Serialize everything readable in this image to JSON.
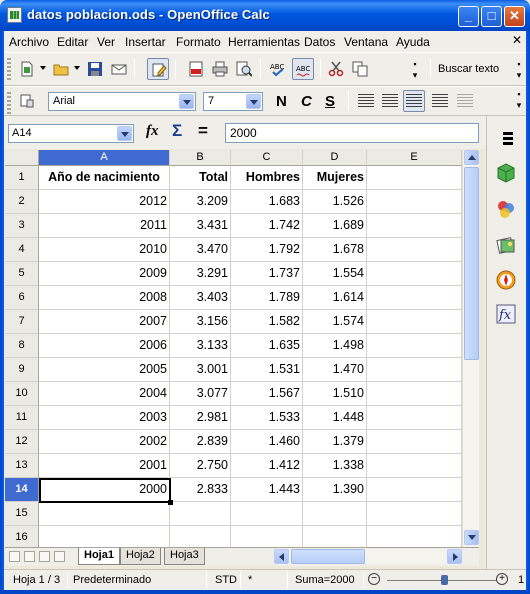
{
  "window": {
    "title": "datos poblacion.ods - OpenOffice Calc",
    "minimize": "_",
    "maximize": "□",
    "close": "✕"
  },
  "menu": [
    "Archivo",
    "Editar",
    "Ver",
    "Insertar",
    "Formato",
    "Herramientas",
    "Datos",
    "Ventana",
    "Ayuda"
  ],
  "menu_close": "✕",
  "toolbar": {
    "find_label": "Buscar texto",
    "font_name": "Arial",
    "font_size": "7",
    "bold": "N",
    "italic": "C",
    "underline": "S"
  },
  "formula_bar": {
    "cell_ref": "A14",
    "fx": "fx",
    "sigma": "Σ",
    "equals": "=",
    "value": "2000"
  },
  "columns": [
    "A",
    "B",
    "C",
    "D",
    "E"
  ],
  "rows": [
    {
      "n": "1",
      "a": "Año de nacimiento",
      "b": "Total",
      "c": "Hombres",
      "d": "Mujeres"
    },
    {
      "n": "2",
      "a": "2012",
      "b": "3.209",
      "c": "1.683",
      "d": "1.526"
    },
    {
      "n": "3",
      "a": "2011",
      "b": "3.431",
      "c": "1.742",
      "d": "1.689"
    },
    {
      "n": "4",
      "a": "2010",
      "b": "3.470",
      "c": "1.792",
      "d": "1.678"
    },
    {
      "n": "5",
      "a": "2009",
      "b": "3.291",
      "c": "1.737",
      "d": "1.554"
    },
    {
      "n": "6",
      "a": "2008",
      "b": "3.403",
      "c": "1.789",
      "d": "1.614"
    },
    {
      "n": "7",
      "a": "2007",
      "b": "3.156",
      "c": "1.582",
      "d": "1.574"
    },
    {
      "n": "8",
      "a": "2006",
      "b": "3.133",
      "c": "1.635",
      "d": "1.498"
    },
    {
      "n": "9",
      "a": "2005",
      "b": "3.001",
      "c": "1.531",
      "d": "1.470"
    },
    {
      "n": "10",
      "a": "2004",
      "b": "3.077",
      "c": "1.567",
      "d": "1.510"
    },
    {
      "n": "11",
      "a": "2003",
      "b": "2.981",
      "c": "1.533",
      "d": "1.448"
    },
    {
      "n": "12",
      "a": "2002",
      "b": "2.839",
      "c": "1.460",
      "d": "1.379"
    },
    {
      "n": "13",
      "a": "2001",
      "b": "2.750",
      "c": "1.412",
      "d": "1.338"
    },
    {
      "n": "14",
      "a": "2000",
      "b": "2.833",
      "c": "1.443",
      "d": "1.390"
    },
    {
      "n": "15",
      "a": "",
      "b": "",
      "c": "",
      "d": ""
    },
    {
      "n": "16",
      "a": "",
      "b": "",
      "c": "",
      "d": ""
    }
  ],
  "sheet_tabs": [
    "Hoja1",
    "Hoja2",
    "Hoja3"
  ],
  "active_sheet": "Hoja1",
  "status": {
    "page": "Hoja 1 / 3",
    "style": "Predeterminado",
    "mode": "STD",
    "modified": "*",
    "sum": "Suma=2000",
    "zoom_minus": "−",
    "zoom_plus": "+",
    "zoom_tail": "1"
  },
  "colors": {
    "selection": "#3f6bd0",
    "titlebar": "#0058e0"
  },
  "icons": {
    "sidebar": [
      "properties-icon",
      "styles-icon",
      "gallery-icon",
      "navigator-icon",
      "functions-icon"
    ]
  }
}
